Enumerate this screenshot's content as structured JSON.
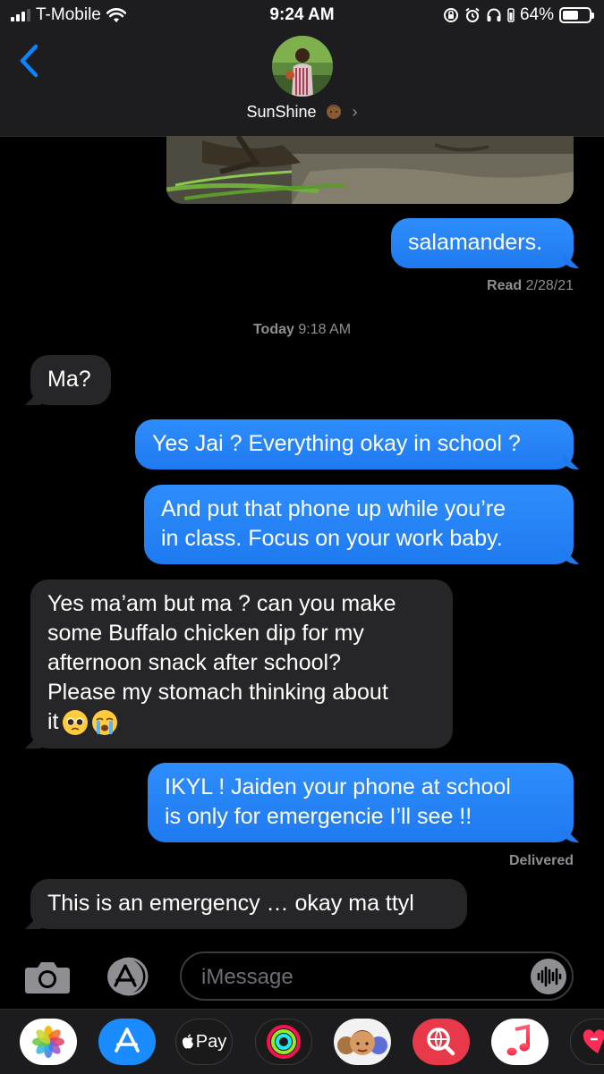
{
  "status_bar": {
    "carrier": "T-Mobile",
    "time": "9:24 AM",
    "battery": "64%"
  },
  "header": {
    "contact_name": "SunShine"
  },
  "messages": [
    {
      "type": "sent",
      "text": "salamanders."
    },
    {
      "type": "receipt",
      "label": "Read",
      "value": "2/28/21"
    },
    {
      "type": "timestamp",
      "label": "Today",
      "value": "9:18 AM"
    },
    {
      "type": "received",
      "text": "Ma?"
    },
    {
      "type": "sent",
      "text": "Yes Jai ? Everything okay in school ?"
    },
    {
      "type": "sent",
      "lines": [
        "And put that phone up while you’re",
        "in class. Focus on your work baby."
      ]
    },
    {
      "type": "received",
      "lines": [
        "Yes ma’am but ma ? can you make",
        "some Buffalo chicken dip for my",
        "afternoon snack after school?",
        "Please my stomach thinking about",
        "it"
      ]
    },
    {
      "type": "sent",
      "lines": [
        "IKYL ! Jaiden your phone at school",
        "is only for emergencie I’ll see !!"
      ]
    },
    {
      "type": "receipt",
      "label": "Delivered"
    },
    {
      "type": "received",
      "text": "This is an emergency … okay ma ttyl"
    }
  ],
  "input": {
    "placeholder": "iMessage"
  },
  "app_drawer": {
    "apple_pay_label": "Pay",
    "icons": [
      "photos-icon",
      "app-store-icon",
      "apple-pay-icon",
      "activity-icon",
      "memoji-icon",
      "web-search-icon",
      "music-icon",
      "heart-app-icon"
    ]
  },
  "colors": {
    "sent_bubble": "#1f7af0",
    "received_bubble": "#262628",
    "header_bg": "#1d1d1f",
    "link_blue": "#0a84ff"
  }
}
